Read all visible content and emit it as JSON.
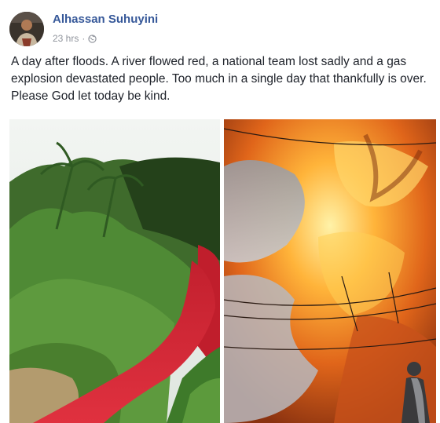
{
  "post": {
    "author": "Alhassan Suhuyini",
    "time": "23 hrs",
    "separator": "·",
    "privacy_icon": "globe-icon",
    "text": "A day after floods. A river flowed red, a national team lost sadly and a gas explosion devastated people. Too much in a single day that thankfully is over. Please God let today be kind."
  },
  "colors": {
    "author_link": "#365899",
    "meta_text": "#90949c",
    "body_text": "#1d2129"
  }
}
